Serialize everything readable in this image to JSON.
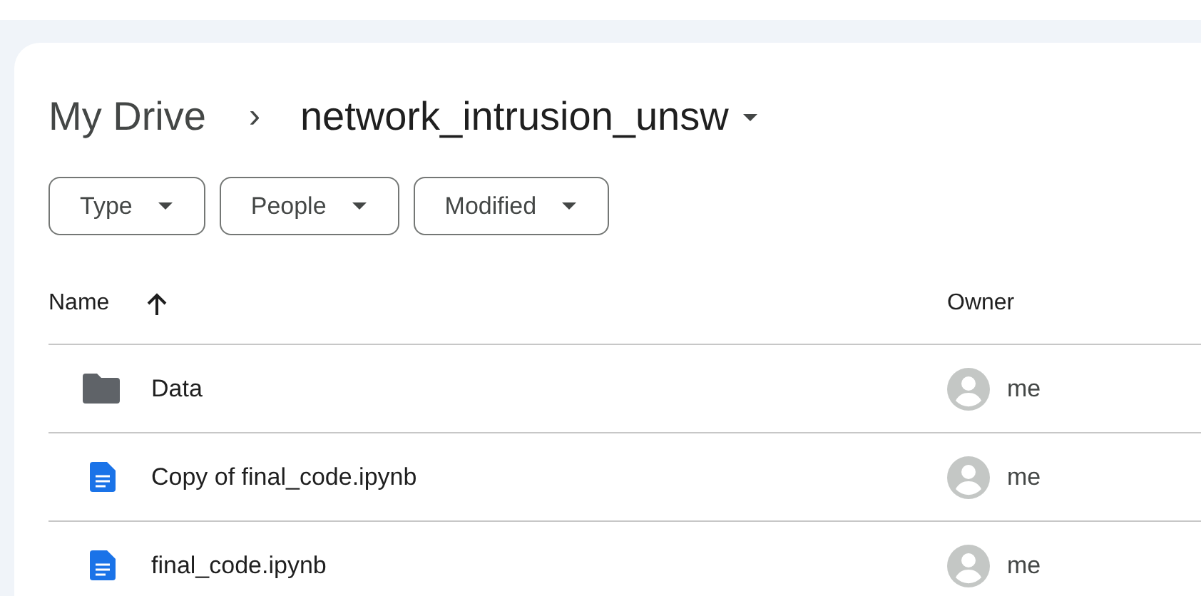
{
  "breadcrumb": {
    "root": "My Drive",
    "separator": "›",
    "current": "network_intrusion_unsw"
  },
  "filters": [
    {
      "label": "Type"
    },
    {
      "label": "People"
    },
    {
      "label": "Modified"
    }
  ],
  "table": {
    "columns": [
      {
        "label": "Name",
        "sorted": true
      },
      {
        "label": "Owner"
      }
    ],
    "rows": [
      {
        "kind": "folder",
        "name": "Data",
        "owner": "me"
      },
      {
        "kind": "doc",
        "name": "Copy of final_code.ipynb",
        "owner": "me"
      },
      {
        "kind": "doc",
        "name": "final_code.ipynb",
        "owner": "me"
      }
    ]
  }
}
